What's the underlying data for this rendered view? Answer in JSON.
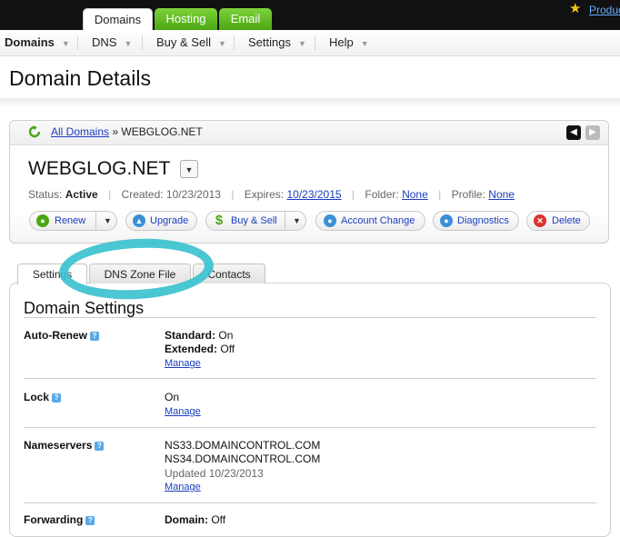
{
  "top_tabs": [
    "Domains",
    "Hosting",
    "Email"
  ],
  "top_right_link": "Produc",
  "menu": [
    {
      "label": "Domains"
    },
    {
      "label": "DNS"
    },
    {
      "label": "Buy & Sell"
    },
    {
      "label": "Settings"
    },
    {
      "label": "Help"
    }
  ],
  "page_title": "Domain Details",
  "breadcrumb": {
    "link": "All Domains",
    "separator": "»",
    "current": "WEBGLOG.NET"
  },
  "domain": {
    "name": "WEBGLOG.NET",
    "status_label": "Status:",
    "status_value": "Active",
    "created_label": "Created:",
    "created_value": "10/23/2013",
    "expires_label": "Expires:",
    "expires_value": "10/23/2015",
    "folder_label": "Folder:",
    "folder_value": "None",
    "profile_label": "Profile:",
    "profile_value": "None"
  },
  "actions": [
    {
      "label": "Renew"
    },
    {
      "label": "Upgrade"
    },
    {
      "label": "Buy & Sell"
    },
    {
      "label": "Account Change"
    },
    {
      "label": "Diagnostics"
    },
    {
      "label": "Delete"
    }
  ],
  "tabs": [
    "Settings",
    "DNS Zone File",
    "Contacts"
  ],
  "section_title": "Domain Settings",
  "settings": {
    "auto_renew": {
      "label": "Auto-Renew",
      "standard_label": "Standard:",
      "standard_value": "On",
      "extended_label": "Extended:",
      "extended_value": "Off",
      "link": "Manage"
    },
    "lock": {
      "label": "Lock",
      "value": "On",
      "link": "Manage"
    },
    "nameservers": {
      "label": "Nameservers",
      "ns1": "NS33.DOMAINCONTROL.COM",
      "ns2": "NS34.DOMAINCONTROL.COM",
      "updated": "Updated 10/23/2013",
      "link": "Manage"
    },
    "forwarding": {
      "label": "Forwarding",
      "domain_label": "Domain:",
      "domain_value": "Off"
    }
  },
  "colors": {
    "accent_link": "#1a3dbf",
    "tab_green": "#4aa712",
    "annotation_ring": "#3cc1cf"
  }
}
